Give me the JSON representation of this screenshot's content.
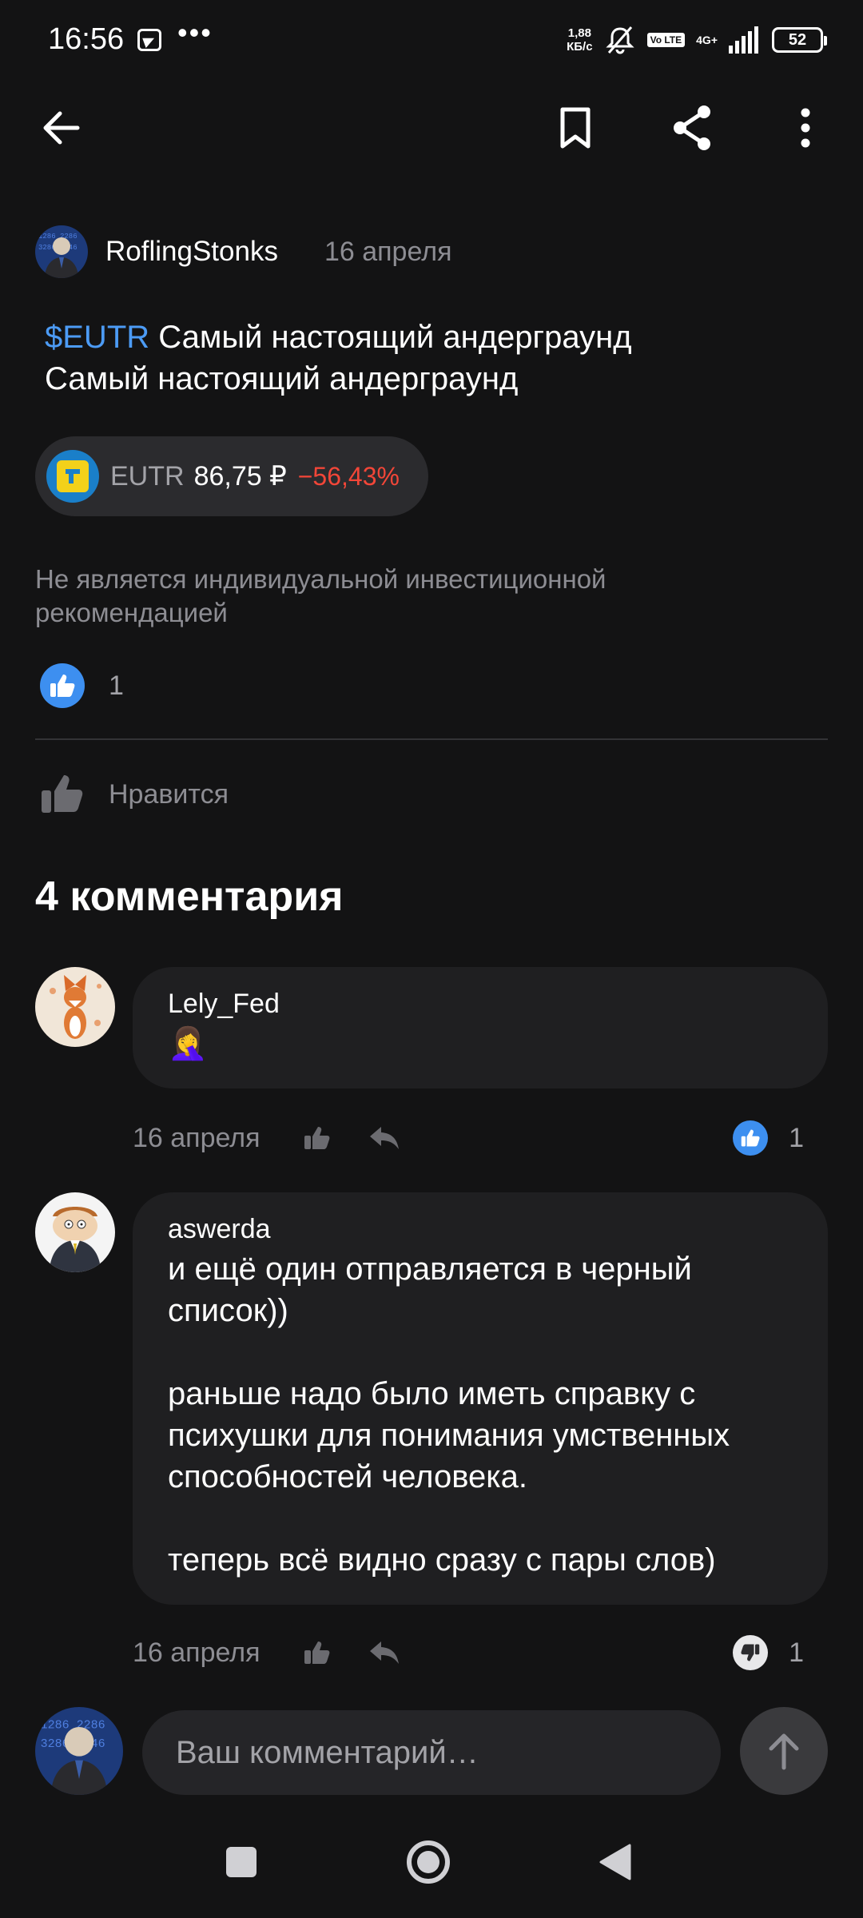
{
  "status_bar": {
    "time": "16:56",
    "speed_value": "1,88",
    "speed_unit": "КБ/с",
    "volte": "Vo LTE",
    "network": "4G+",
    "battery": "52"
  },
  "post": {
    "author": "RoflingStonks",
    "date": "16 апреля",
    "ticker_tag": "$EUTR",
    "text_line1_rest": " Самый настоящий андерграунд",
    "text_line2": "Самый настоящий андерграунд",
    "ticker_chip": {
      "ticker": "EUTR",
      "price": "86,75 ₽",
      "change": "−56,43%"
    },
    "disclaimer": "Не является индивидуальной инвестиционной рекомендацией",
    "likes_count": "1",
    "like_label": "Нравится"
  },
  "comments_title": "4 комментария",
  "comments": [
    {
      "author": "Lely_Fed",
      "text": "🤦‍♀️",
      "date": "16 апреля",
      "rating": "1",
      "rating_type": "like"
    },
    {
      "author": "aswerda",
      "text": "и ещё один отправляется в черный список))\n\nраньше надо было иметь справку с психушки для понимания умственных способностей человека.\n\nтеперь всё видно сразу с пары слов)",
      "date": "16 апреля",
      "rating": "1",
      "rating_type": "dislike"
    }
  ],
  "input": {
    "placeholder": "Ваш комментарий…"
  },
  "colors": {
    "background": "#131314",
    "accent_blue": "#3d8ff0",
    "ticker_link": "#4c9bf5",
    "negative_red": "#f24638",
    "muted_text": "#8d8d93"
  }
}
